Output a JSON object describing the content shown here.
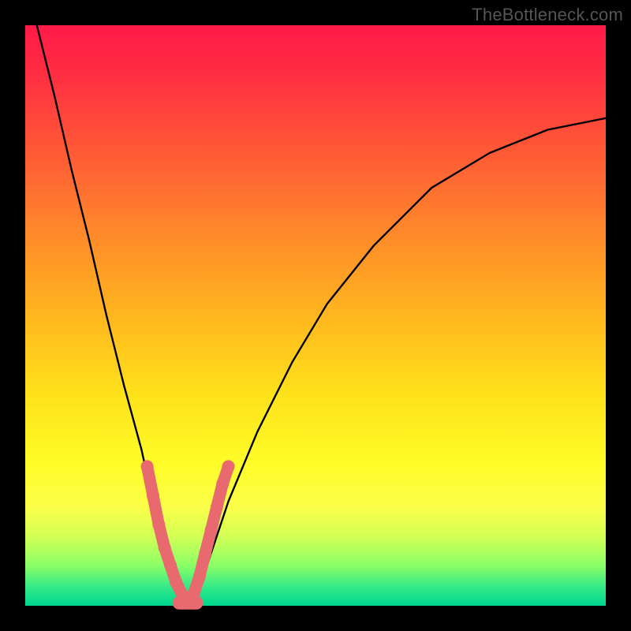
{
  "watermark_text": "TheBottleneck.com",
  "colors": {
    "frame": "#000000",
    "curve": "#000000",
    "bead": "#e86a6e",
    "gradient_stops": [
      "#ff1a49",
      "#ff2d42",
      "#ff5a36",
      "#ff8a2a",
      "#ffb61f",
      "#ffe31a",
      "#fffd2a",
      "#fbff4a",
      "#d4ff55",
      "#8cff66",
      "#30e889",
      "#00d68f"
    ]
  },
  "chart_data": {
    "type": "line",
    "title": "",
    "xlabel": "",
    "ylabel": "",
    "xlim": [
      0,
      100
    ],
    "ylim": [
      0,
      100
    ],
    "grid": false,
    "legend": false,
    "annotations": [],
    "series": [
      {
        "name": "v-curve",
        "x": [
          2,
          5,
          8,
          11,
          14,
          17,
          20,
          22,
          24,
          26,
          28,
          30,
          32,
          35,
          40,
          46,
          52,
          60,
          70,
          80,
          90,
          100
        ],
        "y": [
          100,
          88,
          75,
          63,
          50,
          38,
          27,
          18,
          10,
          4,
          0,
          3,
          9,
          18,
          30,
          42,
          52,
          62,
          72,
          78,
          82,
          84
        ]
      }
    ],
    "markers": {
      "name": "highlight-beads",
      "left_branch": [
        {
          "x": 21,
          "y": 24
        },
        {
          "x": 22,
          "y": 19
        },
        {
          "x": 23,
          "y": 14
        },
        {
          "x": 24,
          "y": 10
        },
        {
          "x": 25,
          "y": 7
        },
        {
          "x": 26,
          "y": 4
        },
        {
          "x": 27,
          "y": 2
        }
      ],
      "right_branch": [
        {
          "x": 29,
          "y": 2
        },
        {
          "x": 30,
          "y": 5
        },
        {
          "x": 31,
          "y": 9
        },
        {
          "x": 32,
          "y": 13
        },
        {
          "x": 33,
          "y": 17
        },
        {
          "x": 34,
          "y": 21
        },
        {
          "x": 35,
          "y": 24
        }
      ],
      "valley_bar": {
        "x0": 26.5,
        "x1": 29.5,
        "y": 0.5
      }
    }
  }
}
